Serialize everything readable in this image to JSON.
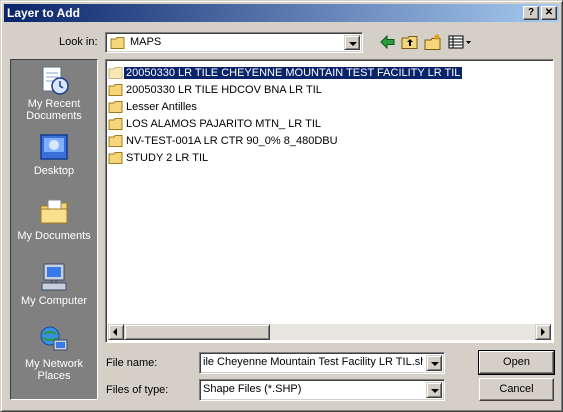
{
  "window": {
    "title": "Layer to Add",
    "help_button": "?",
    "close_button": "✕"
  },
  "toolbar": {
    "look_in_label": "Look in:",
    "look_in_value": "MAPS"
  },
  "places_bar": [
    {
      "label": "My Recent Documents",
      "icon": "recent-documents-icon"
    },
    {
      "label": "Desktop",
      "icon": "desktop-icon"
    },
    {
      "label": "My Documents",
      "icon": "my-documents-icon"
    },
    {
      "label": "My Computer",
      "icon": "my-computer-icon"
    },
    {
      "label": "My Network Places",
      "icon": "network-places-icon"
    }
  ],
  "files": [
    {
      "name": "20050330 LR TILE CHEYENNE MOUNTAIN TEST FACILITY LR TIL",
      "selected": true
    },
    {
      "name": "20050330 LR TILE HDCOV BNA LR TIL",
      "selected": false
    },
    {
      "name": "Lesser Antilles",
      "selected": false
    },
    {
      "name": "LOS ALAMOS PAJARITO MTN_ LR TIL",
      "selected": false
    },
    {
      "name": "NV-TEST-001A LR CTR 90_0% 8_480DBU",
      "selected": false
    },
    {
      "name": "STUDY 2 LR TIL",
      "selected": false
    }
  ],
  "form": {
    "file_name_label": "File name:",
    "file_name_value": "ile Cheyenne Mountain Test Facility LR TIL.shp",
    "files_of_type_label": "Files of type:",
    "files_of_type_value": "Shape Files (*.SHP)"
  },
  "buttons": {
    "open": "Open",
    "cancel": "Cancel"
  },
  "colors": {
    "titlebar_start": "#0a246a",
    "titlebar_end": "#a6caf0",
    "selection": "#0a246a",
    "places_bar": "#808080",
    "face": "#d4d0c8",
    "folder": "#f5d67a"
  }
}
